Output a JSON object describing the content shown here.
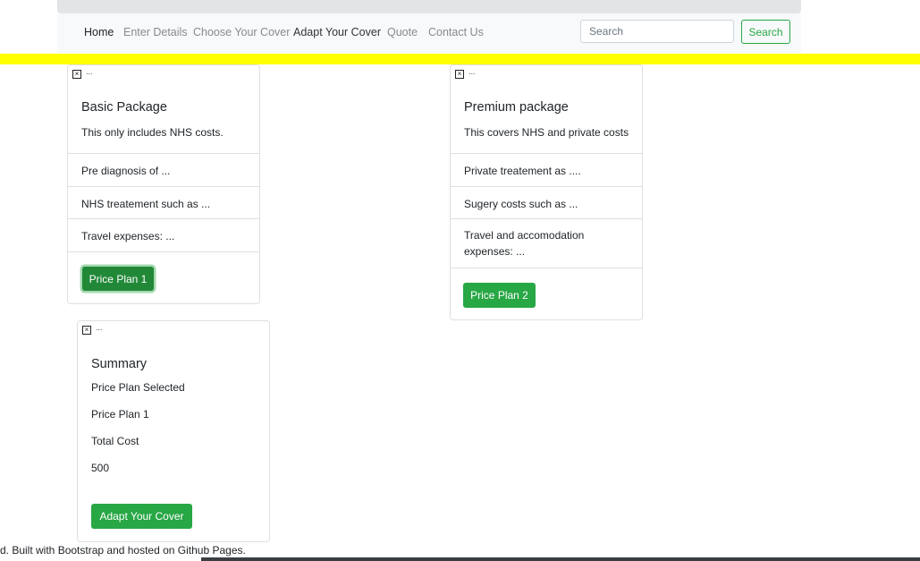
{
  "nav": {
    "links": [
      {
        "label": "Home"
      },
      {
        "label": "Enter Details"
      },
      {
        "label": "Choose Your Cover"
      },
      {
        "label": "Adapt Your Cover"
      },
      {
        "label": "Quote"
      },
      {
        "label": "Contact Us"
      }
    ],
    "search_placeholder": "Search",
    "search_button": "Search"
  },
  "basic_card": {
    "img_alt": "...",
    "title": "Basic Package",
    "text": "This only includes NHS costs.",
    "items": [
      "Pre diagnosis of ...",
      "NHS treatement such as ...",
      "Travel expenses: ..."
    ],
    "button": "Price Plan 1"
  },
  "premium_card": {
    "img_alt": "...",
    "title": "Premium package",
    "text": "This covers NHS and private costs",
    "items": [
      "Private treatement as ....",
      "Sugery costs such as ...",
      "Travel and accomodation expenses: ..."
    ],
    "button": "Price Plan 2"
  },
  "summary_card": {
    "img_alt": "...",
    "title": "Summary",
    "plan_label": "Price Plan Selected",
    "plan_value": "Price Plan 1",
    "cost_label": "Total Cost",
    "cost_value": "500",
    "button": "Adapt Your Cover"
  },
  "footer": {
    "text": "d. Built with Bootstrap and hosted on Github Pages."
  },
  "colors": {
    "accent_green": "#28a745",
    "highlight_yellow": "#ffff00",
    "navbar_bg": "#f8f9fa"
  }
}
